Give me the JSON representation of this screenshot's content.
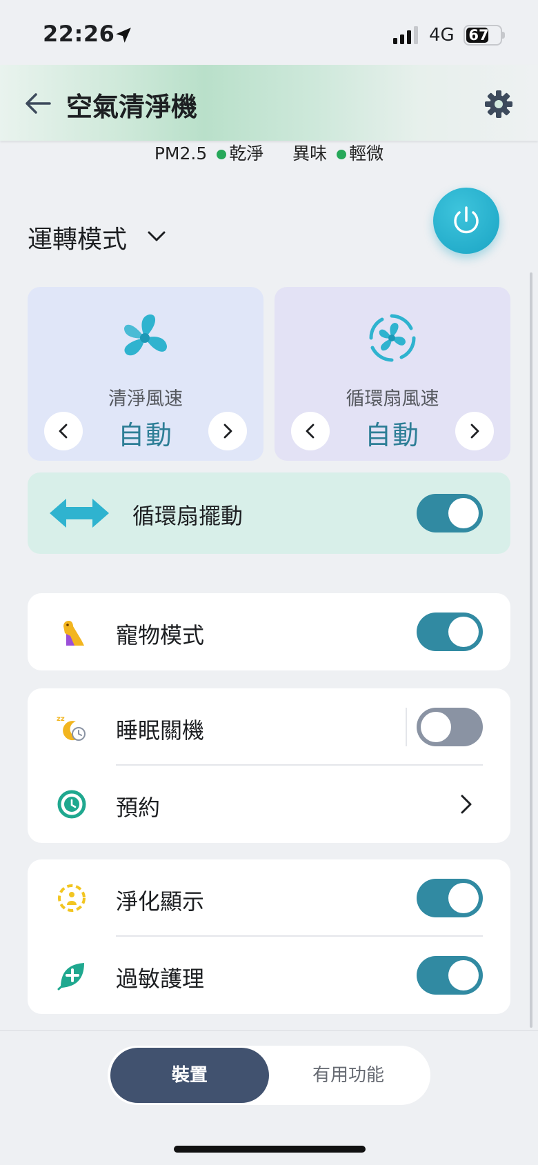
{
  "status_bar": {
    "time": "22:26",
    "network": "4G",
    "battery": "67"
  },
  "header": {
    "title": "空氣清淨機"
  },
  "air_quality": {
    "pm_label": "PM2.5",
    "pm_value": "乾淨",
    "odor_label": "異味",
    "odor_value": "輕微",
    "status_color": "#27a85a"
  },
  "mode": {
    "title": "運轉模式"
  },
  "cards": [
    {
      "icon": "fan-icon",
      "label": "清淨風速",
      "value": "自動"
    },
    {
      "icon": "circulator-fan-icon",
      "label": "循環扇風速",
      "value": "自動"
    }
  ],
  "swing": {
    "label": "循環扇擺動",
    "on": true
  },
  "settings": {
    "pet_mode": {
      "label": "寵物模式",
      "on": true
    },
    "sleep_off": {
      "label": "睡眠關機",
      "on": false
    },
    "schedule": {
      "label": "預約"
    },
    "purify_display": {
      "label": "淨化顯示",
      "on": true
    },
    "allergy_care": {
      "label": "過敏護理",
      "on": true
    }
  },
  "tabs": {
    "device": "裝置",
    "features": "有用功能",
    "active": "device"
  },
  "colors": {
    "accent": "#318aa2",
    "power": "#1aa4c4",
    "active_tab": "#41526f"
  }
}
